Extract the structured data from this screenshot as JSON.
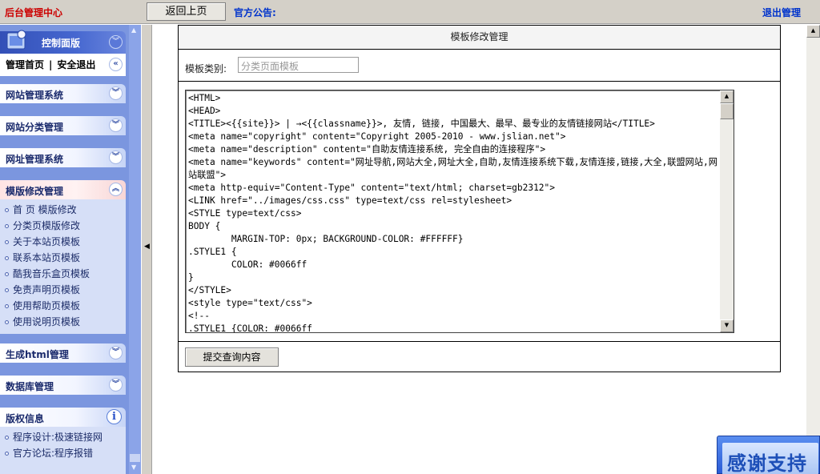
{
  "topbar": {
    "brand": "后台管理中心",
    "back_button": "返回上页",
    "notice_label": "官方公告:",
    "logout": "退出管理"
  },
  "sidebar": {
    "control_panel": {
      "title": "控制面版",
      "home": "管理首页",
      "separator": "|",
      "safe_exit": "安全退出"
    },
    "sections": [
      {
        "title": "网站管理系统"
      },
      {
        "title": "网站分类管理"
      },
      {
        "title": "网址管理系统"
      },
      {
        "title": "模版修改管理"
      },
      {
        "title": "生成html管理"
      },
      {
        "title": "数据库管理"
      }
    ],
    "template_items": [
      "首 页 模版修改",
      "分类页模版修改",
      "关于本站页模板",
      "联系本站页模板",
      "酷我音乐盒页模板",
      "免责声明页模板",
      "使用帮助页模板",
      "使用说明页模板"
    ],
    "copyright": {
      "title": "版权信息",
      "items": [
        "程序设计:极速链接网",
        "官方论坛:程序报错"
      ]
    }
  },
  "main": {
    "header": "模板修改管理",
    "category_label": "模板类别:",
    "category_value": "分类页面模板",
    "code": "<HTML>\n<HEAD>\n<TITLE><{{site}}> | →<{{classname}}>, 友情, 链接, 中国最大、最早、最专业的友情链接网站</TITLE>\n<meta name=\"copyright\" content=\"Copyright 2005-2010 - www.jslian.net\">\n<meta name=\"description\" content=\"自助友情连接系统, 完全自由的连接程序\">\n<meta name=\"keywords\" content=\"网址导航,网站大全,网址大全,自助,友情连接系统下载,友情连接,链接,大全,联盟网站,网站联盟\">\n<meta http-equiv=\"Content-Type\" content=\"text/html; charset=gb2312\">\n<LINK href=\"../images/css.css\" type=text/css rel=stylesheet>\n<STYLE type=text/css>\nBODY {\n        MARGIN-TOP: 0px; BACKGROUND-COLOR: #FFFFFF}\n.STYLE1 {\n        COLOR: #0066ff\n}\n</STYLE>\n<style type=\"text/css\">\n<!--\n.STYLE1 {COLOR: #0066ff",
    "submit": "提交查询内容"
  },
  "thanks_badge": "感谢支持",
  "colors": {
    "brand_red": "#cc0000",
    "link_blue": "#0033cc",
    "sidebar_bg": "#7b96df"
  }
}
